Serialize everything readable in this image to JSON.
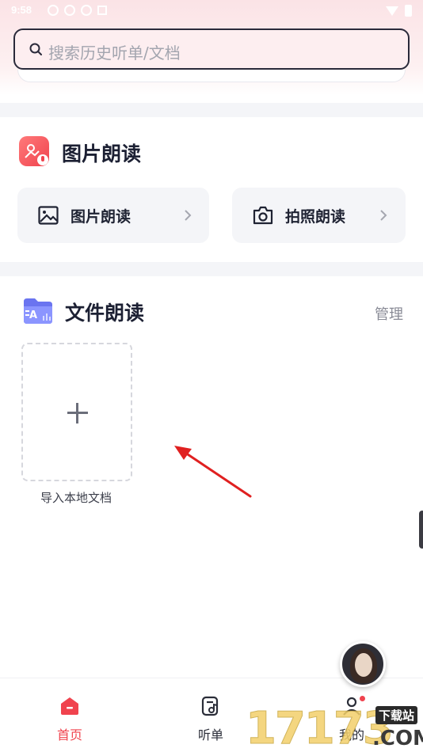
{
  "status_bar": {
    "time": "9:58"
  },
  "search": {
    "placeholder": "搜索历史听单/文档"
  },
  "picture_section": {
    "title": "图片朗读",
    "cards": [
      {
        "label": "图片朗读",
        "icon": "image-icon"
      },
      {
        "label": "拍照朗读",
        "icon": "camera-icon"
      }
    ]
  },
  "file_section": {
    "title": "文件朗读",
    "manage_label": "管理",
    "import_label": "导入本地文档"
  },
  "bottom_nav": [
    {
      "label": "首页",
      "icon": "home-icon",
      "active": true
    },
    {
      "label": "听单",
      "icon": "playlist-icon",
      "active": false
    },
    {
      "label": "我的",
      "icon": "profile-icon",
      "active": false
    }
  ],
  "watermark": {
    "number": "17173",
    "top": "下载站",
    "suffix": ".COM"
  },
  "colors": {
    "accent": "#f0434e",
    "card_bg": "#f4f5f8",
    "annotation_arrow": "#e02020"
  }
}
